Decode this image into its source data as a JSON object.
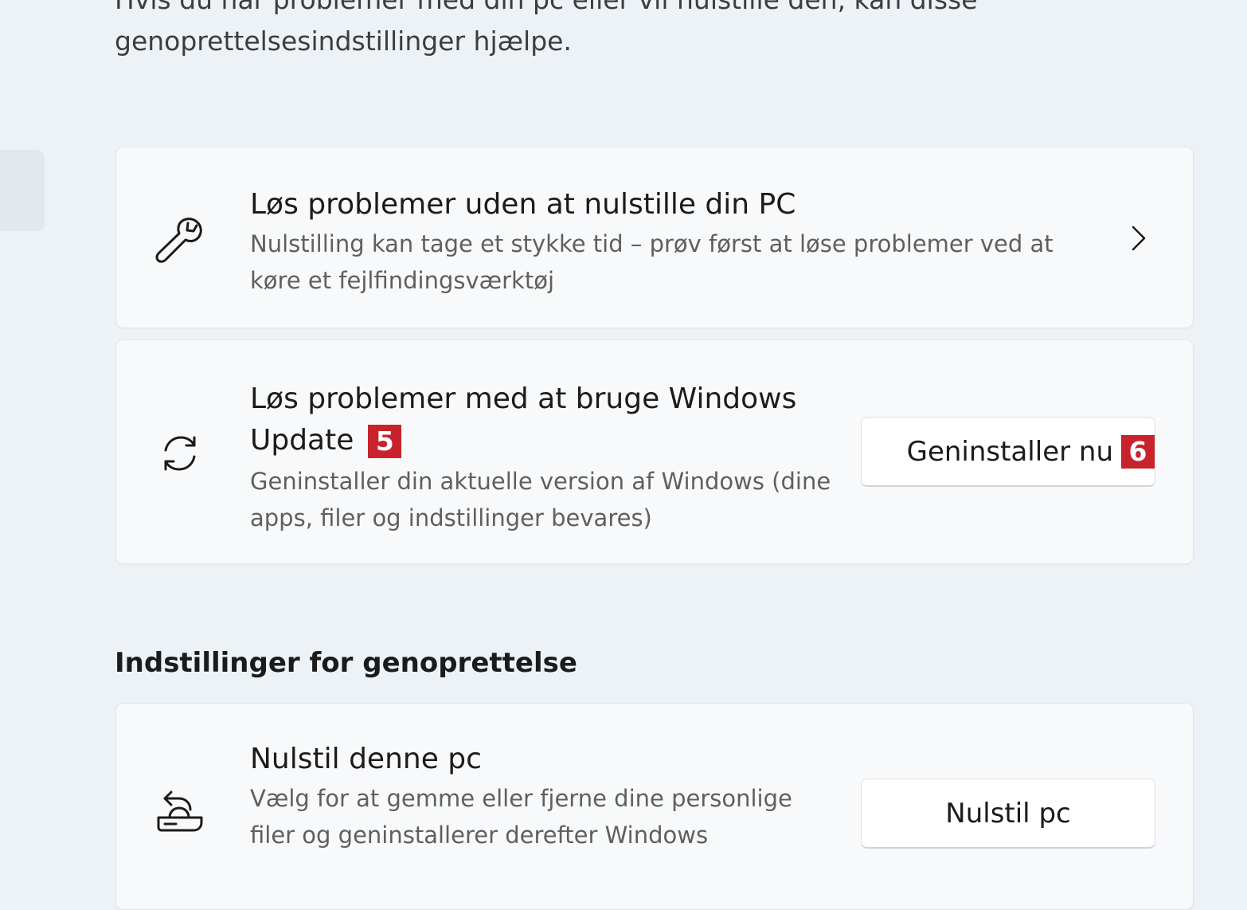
{
  "intro_text": "Hvis du har problemer med din pc eller vil nulstille den, kan disse genoprettelsesindstillinger hjælpe.",
  "cards": {
    "troubleshoot": {
      "icon": "wrench-icon",
      "title": "Løs problemer uden at nulstille din PC",
      "description": "Nulstilling kan tage et stykke tid – prøv først at løse problemer ved at køre et fejlfindingsværktøj"
    },
    "windows_update": {
      "icon": "sync-icon",
      "title": "Løs problemer med at bruge Windows Update",
      "title_badge": "5",
      "description": "Geninstaller din aktuelle version af Windows (dine apps, filer og indstillinger bevares)",
      "button_label": "Geninstaller nu",
      "button_badge": "6"
    },
    "reset_pc": {
      "icon": "reset-pc-icon",
      "title": "Nulstil denne pc",
      "description": "Vælg for at gemme eller fjerne dine personlige filer og geninstallerer derefter Windows",
      "button_label": "Nulstil pc"
    }
  },
  "section_title": "Indstillinger for genoprettelse",
  "colors": {
    "background": "#edf2f7",
    "card": "#f8f9fa",
    "badge": "#c8232c"
  }
}
